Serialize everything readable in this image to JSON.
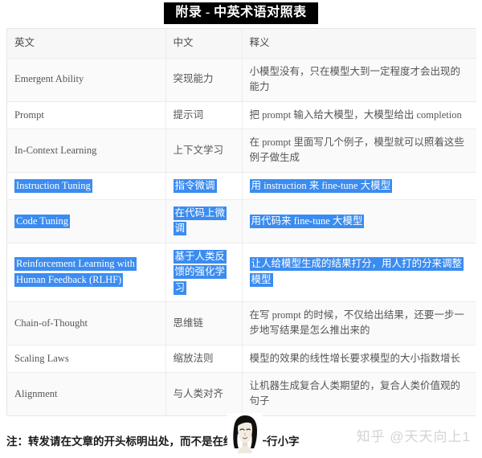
{
  "title": {
    "banner_text": "附录 - 中英术语对照表"
  },
  "table": {
    "headers": [
      "英文",
      "中文",
      "释义"
    ],
    "rows": [
      {
        "en": "Emergent Ability",
        "zh": "突现能力",
        "def": "小模型没有，只在模型大到一定程度才会出现的能力",
        "highlighted": false
      },
      {
        "en": "Prompt",
        "zh": "提示词",
        "def": "把 prompt 输入给大模型，大模型给出 completion",
        "highlighted": false
      },
      {
        "en": "In-Context Learning",
        "zh": "上下文学习",
        "def": "在 prompt 里面写几个例子，模型就可以照着这些例子做生成",
        "highlighted": false
      },
      {
        "en": "Instruction Tuning",
        "zh": "指令微调",
        "def": "用 instruction 来 fine-tune 大模型",
        "highlighted": true
      },
      {
        "en": "Code Tuning",
        "zh": "在代码上微调",
        "def": "用代码来 fine-tune 大模型",
        "highlighted": true
      },
      {
        "en": "Reinforcement Learning with Human Feedback (RLHF)",
        "zh": "基于人类反馈的强化学习",
        "def": "让人给模型生成的结果打分，用人打的分来调整模型",
        "highlighted": true
      },
      {
        "en": "Chain-of-Thought",
        "zh": "思维链",
        "def": "在写 prompt 的时候，不仅给出结果，还要一步一步地写结果是怎么推出来的",
        "highlighted": false
      },
      {
        "en": "Scaling Laws",
        "zh": "缩放法则",
        "def": "模型的效果的线性增长要求模型的大小指数增长",
        "highlighted": false
      },
      {
        "en": "Alignment",
        "zh": "与人类对齐",
        "def": "让机器生成复合人类期望的，复合人类价值观的句子",
        "highlighted": false
      }
    ]
  },
  "note": {
    "text": "注：转发请在文章的开头标明出处，而不是在结尾列一行小字"
  },
  "watermark": {
    "text": "知乎 @天天向上1"
  },
  "colors": {
    "highlight": "#3b8cf0",
    "banner_bg": "#000000",
    "banner_fg": "#ffffff",
    "text": "#555555",
    "watermark": "#d3d3d3"
  }
}
